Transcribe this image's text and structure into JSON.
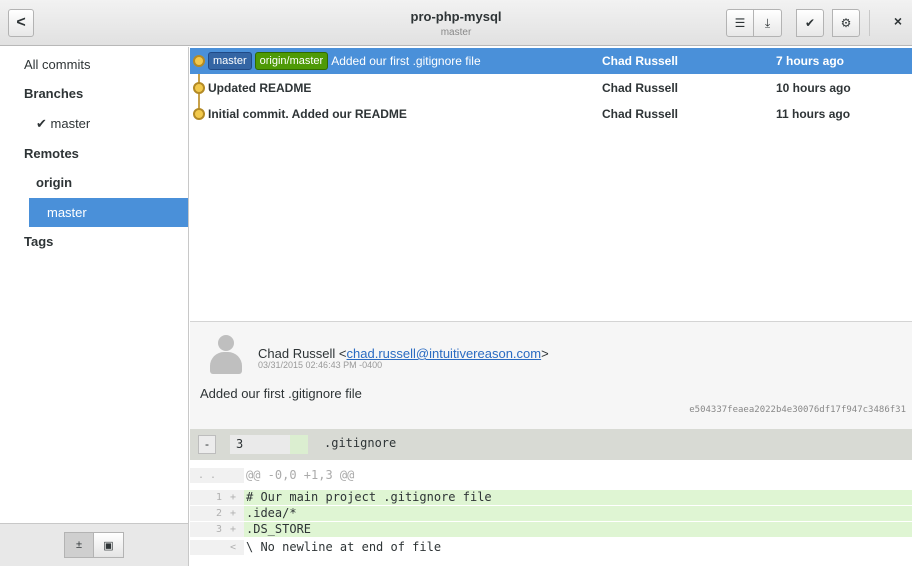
{
  "header": {
    "title": "pro-php-mysql",
    "subtitle": "master",
    "back_label": "<",
    "close_label": "×",
    "toolbar_icons": [
      "list-icon",
      "download-icon",
      "checkmark-icon",
      "gear-icon"
    ]
  },
  "sidebar": {
    "all_commits": "All commits",
    "branches_heading": "Branches",
    "branch_master": "✔ master",
    "remotes_heading": "Remotes",
    "remote_origin": "origin",
    "remote_master": "master",
    "tags_heading": "Tags"
  },
  "commits": [
    {
      "refs": [
        "master",
        "origin/master"
      ],
      "message": "Added our first .gitignore file",
      "author": "Chad Russell",
      "date": "7 hours ago",
      "selected": true
    },
    {
      "refs": [],
      "message": "Updated README",
      "author": "Chad Russell",
      "date": "10 hours ago",
      "selected": false
    },
    {
      "refs": [],
      "message": "Initial commit. Added our README",
      "author": "Chad Russell",
      "date": "11 hours ago",
      "selected": false
    }
  ],
  "details": {
    "author_name": "Chad Russell <",
    "author_email": "chad.russell@intuitivereason.com",
    "author_close": ">",
    "date": "03/31/2015 02:46:43 PM -0400",
    "subject": "Added our first .gitignore file",
    "sha": "e504337feaea2022b4e30076df17f947c3486f31"
  },
  "diff": {
    "collapse_label": "-",
    "added_count": "3",
    "filename": ".gitignore",
    "hunk_gutter": ". .",
    "hunk": "@@ -0,0 +1,3 @@",
    "lines": [
      {
        "num": "1",
        "mark": "+",
        "text": "# Our main project .gitignore file"
      },
      {
        "num": "2",
        "mark": "+",
        "text": ".idea/*"
      },
      {
        "num": "3",
        "mark": "+",
        "text": ".DS_STORE"
      }
    ],
    "nonewline_mark": "<",
    "nonewline": "\\ No newline at end of file"
  },
  "colors": {
    "selection": "#4a90d9",
    "added_bg": "#dff5d3",
    "node": "#f2c94c"
  }
}
